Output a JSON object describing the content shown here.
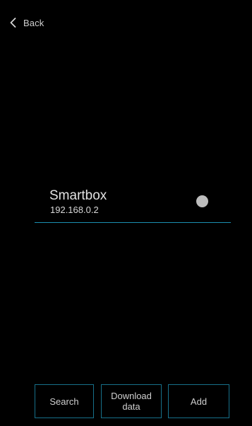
{
  "nav": {
    "back_label": "Back",
    "back_icon": "chevron-left-icon"
  },
  "device": {
    "name": "Smartbox",
    "ip": "192.168.0.2",
    "status_color": "#bdbdbd",
    "underline_color": "#1b8fb0"
  },
  "actions": {
    "search_label": "Search",
    "download_label": "Download data",
    "add_label": "Add",
    "border_color": "#17708a"
  }
}
